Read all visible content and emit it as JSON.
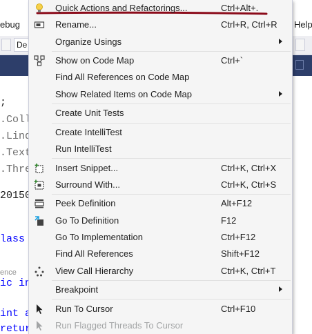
{
  "background": {
    "menubar_fragments": [
      {
        "name": "menubar-debug-fragment",
        "text": "ebug"
      },
      {
        "name": "menubar-help-fragment",
        "text": "Help"
      }
    ],
    "toolbar_dropdown_text": "De",
    "code_lines": [
      {
        "name": "code-line-1",
        "segments": [
          {
            "t": ";",
            "c": ""
          }
        ]
      },
      {
        "name": "code-line-2",
        "segments": [
          {
            "t": ".Coll",
            "c": "dim"
          }
        ]
      },
      {
        "name": "code-line-3",
        "segments": [
          {
            "t": ".Linq",
            "c": "dim"
          }
        ]
      },
      {
        "name": "code-line-4",
        "segments": [
          {
            "t": ".Text",
            "c": "dim"
          }
        ]
      },
      {
        "name": "code-line-5",
        "segments": [
          {
            "t": ".Thre",
            "c": "dim"
          }
        ]
      },
      {
        "name": "code-line-6",
        "segments": [
          {
            "t": "20150",
            "c": ""
          }
        ]
      },
      {
        "name": "code-line-7",
        "segments": [
          {
            "t": "lass",
            "c": "kw"
          }
        ]
      },
      {
        "name": "code-line-8",
        "segments": [
          {
            "t": "ence",
            "c": "codelens"
          }
        ]
      },
      {
        "name": "code-line-9",
        "segments": [
          {
            "t": "ic in",
            "c": "kw"
          }
        ]
      },
      {
        "name": "code-line-10",
        "segments": [
          {
            "t": "int a",
            "c": "kw"
          }
        ]
      },
      {
        "name": "code-line-11",
        "segments": [
          {
            "t": "retur",
            "c": "kw"
          }
        ]
      }
    ]
  },
  "context_menu": {
    "accent_color": "#8b0b1a",
    "items": [
      {
        "name": "menu-item-quick-actions",
        "label": "Quick Actions and Refactorings...",
        "shortcut": "Ctrl+Alt+.",
        "icon": "lightbulb-icon",
        "submenu": false,
        "disabled": false
      },
      {
        "name": "menu-item-rename",
        "label": "Rename...",
        "shortcut": "Ctrl+R, Ctrl+R",
        "icon": "rename-icon",
        "submenu": false,
        "disabled": false
      },
      {
        "name": "menu-item-organize-usings",
        "label": "Organize Usings",
        "shortcut": "",
        "icon": "",
        "submenu": true,
        "disabled": false
      },
      {
        "separator": true
      },
      {
        "name": "menu-item-show-on-code-map",
        "label": "Show on Code Map",
        "shortcut": "Ctrl+`",
        "icon": "code-map-icon",
        "submenu": false,
        "disabled": false
      },
      {
        "name": "menu-item-find-refs-code-map",
        "label": "Find All References on Code Map",
        "shortcut": "",
        "icon": "",
        "submenu": false,
        "disabled": false
      },
      {
        "name": "menu-item-show-related-code-map",
        "label": "Show Related Items on Code Map",
        "shortcut": "",
        "icon": "",
        "submenu": true,
        "disabled": false
      },
      {
        "separator": true
      },
      {
        "name": "menu-item-create-unit-tests",
        "label": "Create Unit Tests",
        "shortcut": "",
        "icon": "",
        "submenu": false,
        "disabled": false
      },
      {
        "separator": true
      },
      {
        "name": "menu-item-create-intellitest",
        "label": "Create IntelliTest",
        "shortcut": "",
        "icon": "",
        "submenu": false,
        "disabled": false
      },
      {
        "name": "menu-item-run-intellitest",
        "label": "Run IntelliTest",
        "shortcut": "",
        "icon": "",
        "submenu": false,
        "disabled": false
      },
      {
        "separator": true
      },
      {
        "name": "menu-item-insert-snippet",
        "label": "Insert Snippet...",
        "shortcut": "Ctrl+K, Ctrl+X",
        "icon": "insert-snippet-icon",
        "submenu": false,
        "disabled": false
      },
      {
        "name": "menu-item-surround-with",
        "label": "Surround With...",
        "shortcut": "Ctrl+K, Ctrl+S",
        "icon": "surround-with-icon",
        "submenu": false,
        "disabled": false
      },
      {
        "separator": true
      },
      {
        "name": "menu-item-peek-definition",
        "label": "Peek Definition",
        "shortcut": "Alt+F12",
        "icon": "peek-definition-icon",
        "submenu": false,
        "disabled": false
      },
      {
        "name": "menu-item-go-to-definition",
        "label": "Go To Definition",
        "shortcut": "F12",
        "icon": "go-to-definition-icon",
        "submenu": false,
        "disabled": false
      },
      {
        "name": "menu-item-go-to-implementation",
        "label": "Go To Implementation",
        "shortcut": "Ctrl+F12",
        "icon": "",
        "submenu": false,
        "disabled": false
      },
      {
        "name": "menu-item-find-all-references",
        "label": "Find All References",
        "shortcut": "Shift+F12",
        "icon": "",
        "submenu": false,
        "disabled": false
      },
      {
        "name": "menu-item-view-call-hierarchy",
        "label": "View Call Hierarchy",
        "shortcut": "Ctrl+K, Ctrl+T",
        "icon": "call-hierarchy-icon",
        "submenu": false,
        "disabled": false
      },
      {
        "separator": true
      },
      {
        "name": "menu-item-breakpoint",
        "label": "Breakpoint",
        "shortcut": "",
        "icon": "",
        "submenu": true,
        "disabled": false
      },
      {
        "separator": true
      },
      {
        "name": "menu-item-run-to-cursor",
        "label": "Run To Cursor",
        "shortcut": "Ctrl+F10",
        "icon": "run-to-cursor-icon",
        "submenu": false,
        "disabled": false
      },
      {
        "name": "menu-item-run-flagged-threads",
        "label": "Run Flagged Threads To Cursor",
        "shortcut": "",
        "icon": "run-flagged-threads-icon",
        "submenu": false,
        "disabled": true
      }
    ]
  }
}
